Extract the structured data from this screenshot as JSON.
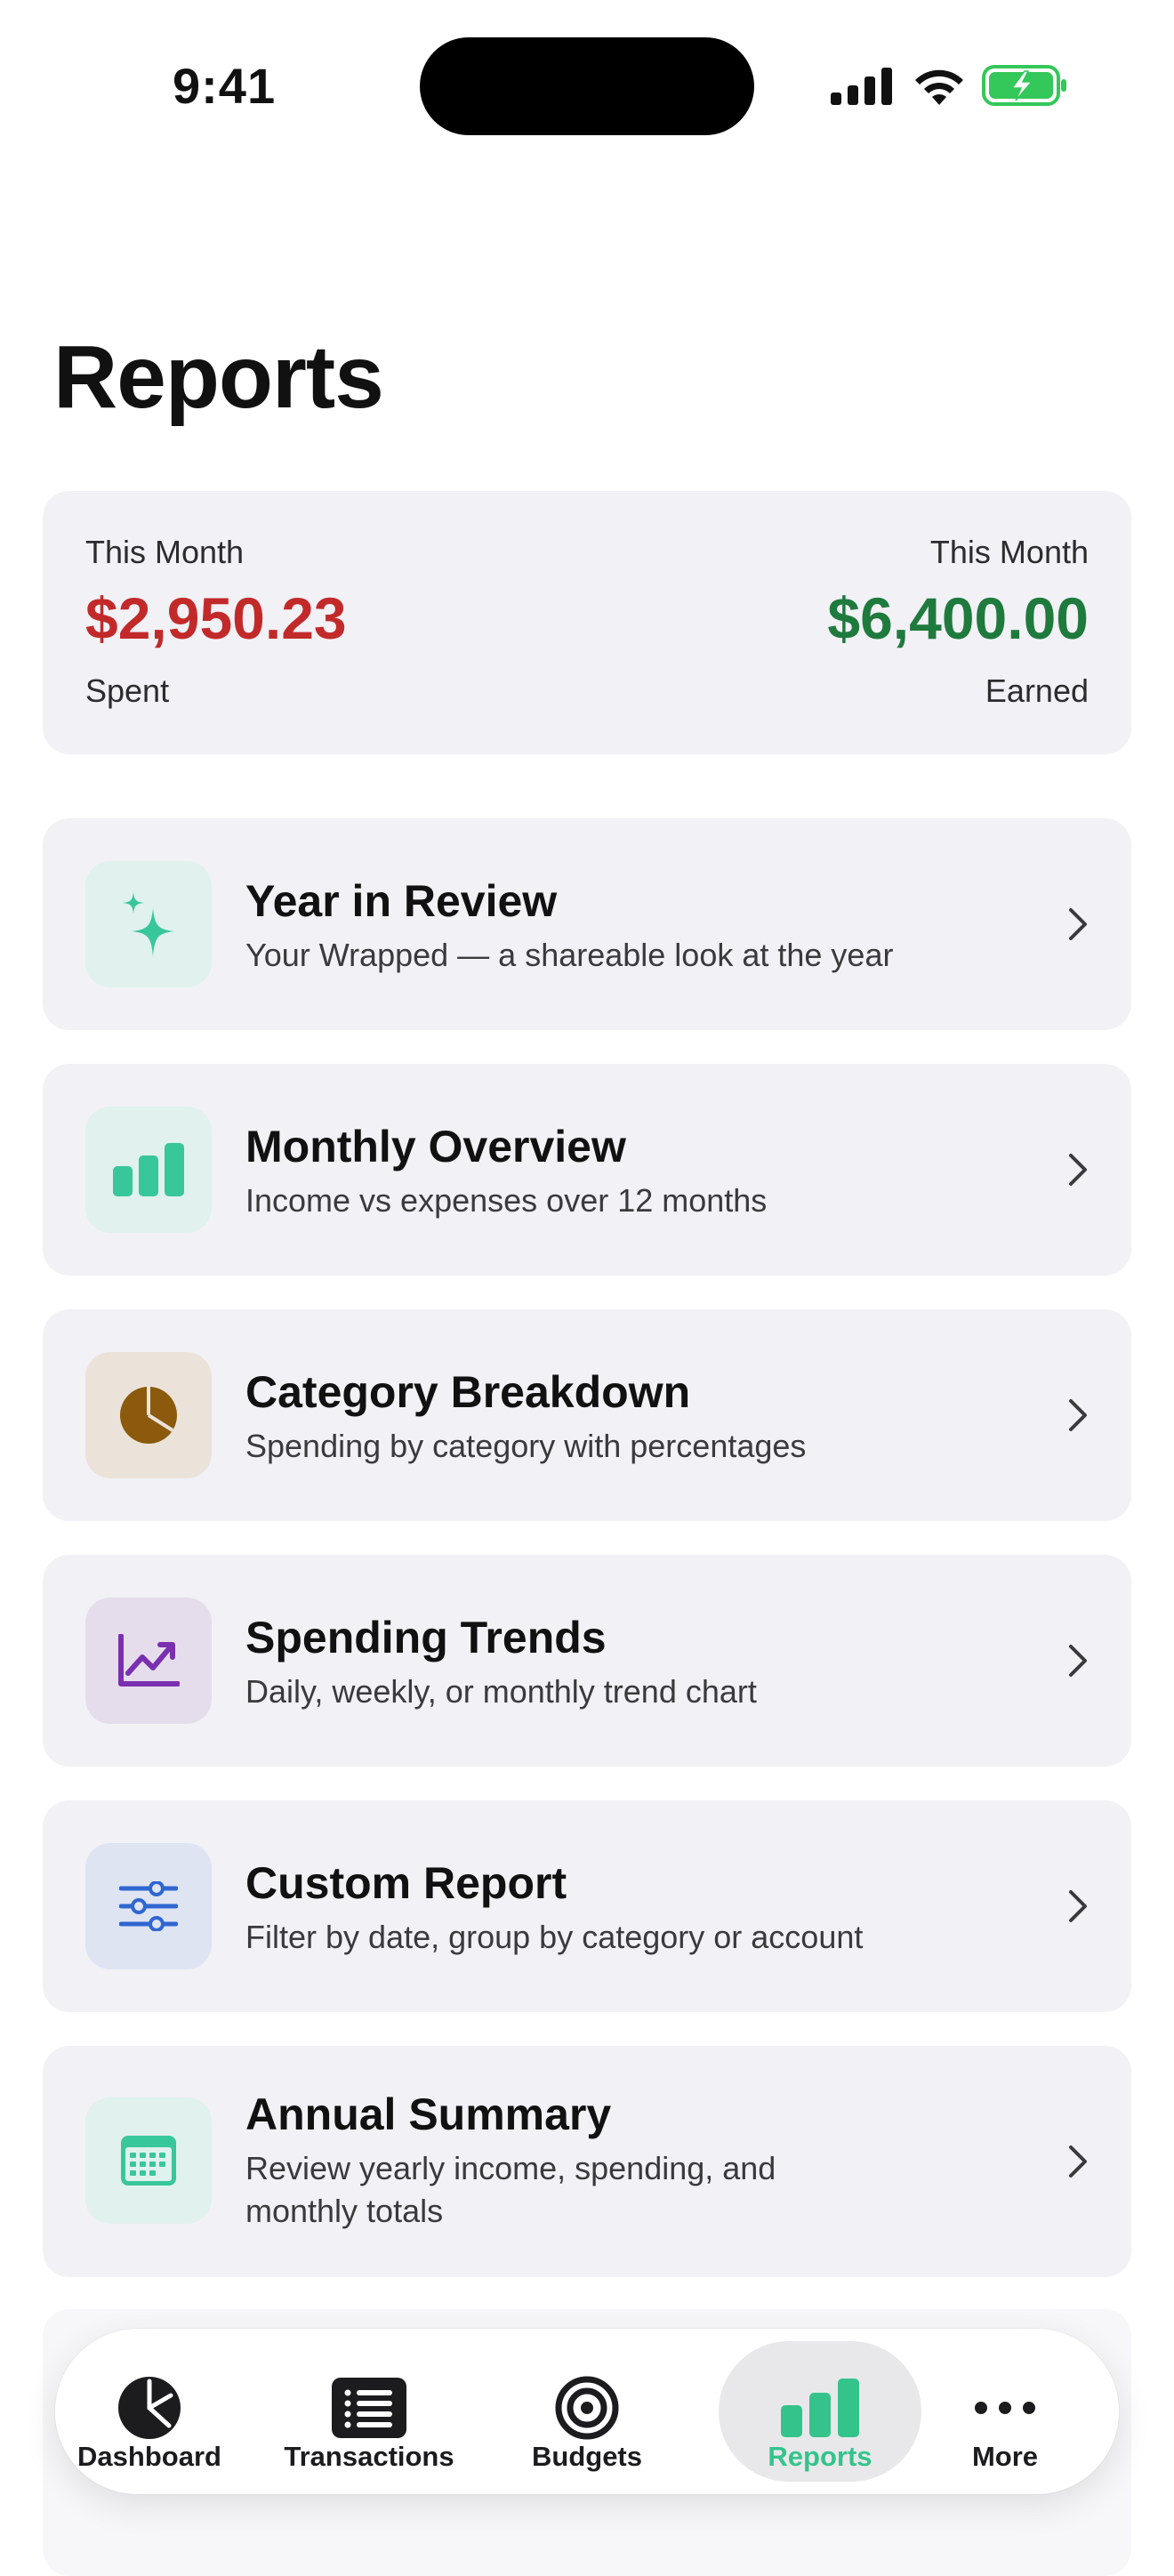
{
  "status_bar": {
    "time": "9:41"
  },
  "page": {
    "title": "Reports"
  },
  "summary": {
    "spent": {
      "label": "This Month",
      "amount": "$2,950.23",
      "caption": "Spent",
      "color": "#c22a2a"
    },
    "earned": {
      "label": "This Month",
      "amount": "$6,400.00",
      "caption": "Earned",
      "color": "#1f7a3d"
    }
  },
  "reports": [
    {
      "title": "Year in Review",
      "subtitle": "Your Wrapped — a shareable look at the year",
      "icon": "sparkles-icon",
      "icon_bg": "#e0f1ee",
      "icon_color": "#38c79a"
    },
    {
      "title": "Monthly Overview",
      "subtitle": "Income vs expenses over 12 months",
      "icon": "bar-chart-icon",
      "icon_bg": "#e0f1ee",
      "icon_color": "#38c79a"
    },
    {
      "title": "Category Breakdown",
      "subtitle": "Spending by category with percentages",
      "icon": "pie-chart-icon",
      "icon_bg": "#ebe3da",
      "icon_color": "#8b5a0c"
    },
    {
      "title": "Spending Trends",
      "subtitle": "Daily, weekly, or monthly trend chart",
      "icon": "trend-chart-icon",
      "icon_bg": "#e6ddec",
      "icon_color": "#7a2fb0"
    },
    {
      "title": "Custom Report",
      "subtitle": "Filter by date, group by category or account",
      "icon": "sliders-icon",
      "icon_bg": "#dfe4f3",
      "icon_color": "#2f66d0"
    },
    {
      "title": "Annual Summary",
      "subtitle": "Review yearly income, spending, and monthly totals",
      "icon": "calendar-icon",
      "icon_bg": "#e0f1ee",
      "icon_color": "#38c79a"
    }
  ],
  "tab_bar": {
    "active_color": "#34c48b",
    "tabs": [
      {
        "label": "Dashboard",
        "icon": "dashboard-pie-icon",
        "active": false
      },
      {
        "label": "Transactions",
        "icon": "list-icon",
        "active": false
      },
      {
        "label": "Budgets",
        "icon": "target-icon",
        "active": false
      },
      {
        "label": "Reports",
        "icon": "bar-chart-icon",
        "active": true
      },
      {
        "label": "More",
        "icon": "ellipsis-icon",
        "active": false
      }
    ]
  }
}
